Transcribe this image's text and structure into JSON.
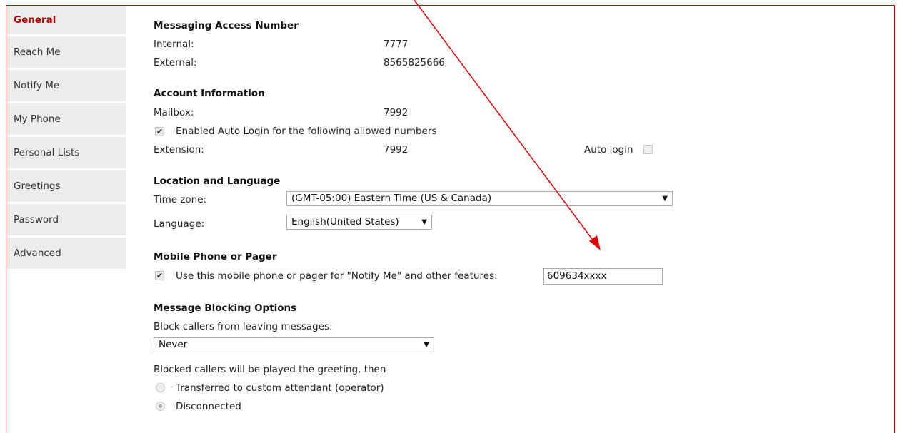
{
  "sidebar": {
    "items": [
      {
        "label": "General"
      },
      {
        "label": "Reach Me"
      },
      {
        "label": "Notify Me"
      },
      {
        "label": "My Phone"
      },
      {
        "label": "Personal Lists"
      },
      {
        "label": "Greetings"
      },
      {
        "label": "Password"
      },
      {
        "label": "Advanced"
      }
    ]
  },
  "messaging_access": {
    "heading": "Messaging Access Number",
    "internal_label": "Internal:",
    "internal_value": "7777",
    "external_label": "External:",
    "external_value": "8565825666"
  },
  "account": {
    "heading": "Account Information",
    "mailbox_label": "Mailbox:",
    "mailbox_value": "7992",
    "auto_login_checkbox_label": "Enabled Auto Login for the following allowed numbers",
    "auto_login_checked": true,
    "extension_label": "Extension:",
    "extension_value": "7992",
    "auto_login_label": "Auto login",
    "auto_login_ext_checked": false
  },
  "location": {
    "heading": "Location and Language",
    "timezone_label": "Time zone:",
    "timezone_value": "(GMT-05:00) Eastern Time (US & Canada)",
    "language_label": "Language:",
    "language_value": "English(United States)"
  },
  "mobile": {
    "heading": "Mobile Phone or Pager",
    "checkbox_label": "Use this mobile phone or pager for \"Notify Me\" and other features:",
    "checked": true,
    "number_value": "609634xxxx"
  },
  "blocking": {
    "heading": "Message Blocking Options",
    "block_label": "Block callers from leaving messages:",
    "block_value": "Never",
    "played_label": "Blocked callers will be played the greeting, then",
    "option_transfer": "Transferred to custom attendant (operator)",
    "option_disconnect": "Disconnected",
    "selected_option": "Disconnected"
  },
  "annotation": {
    "color": "#e00000"
  }
}
